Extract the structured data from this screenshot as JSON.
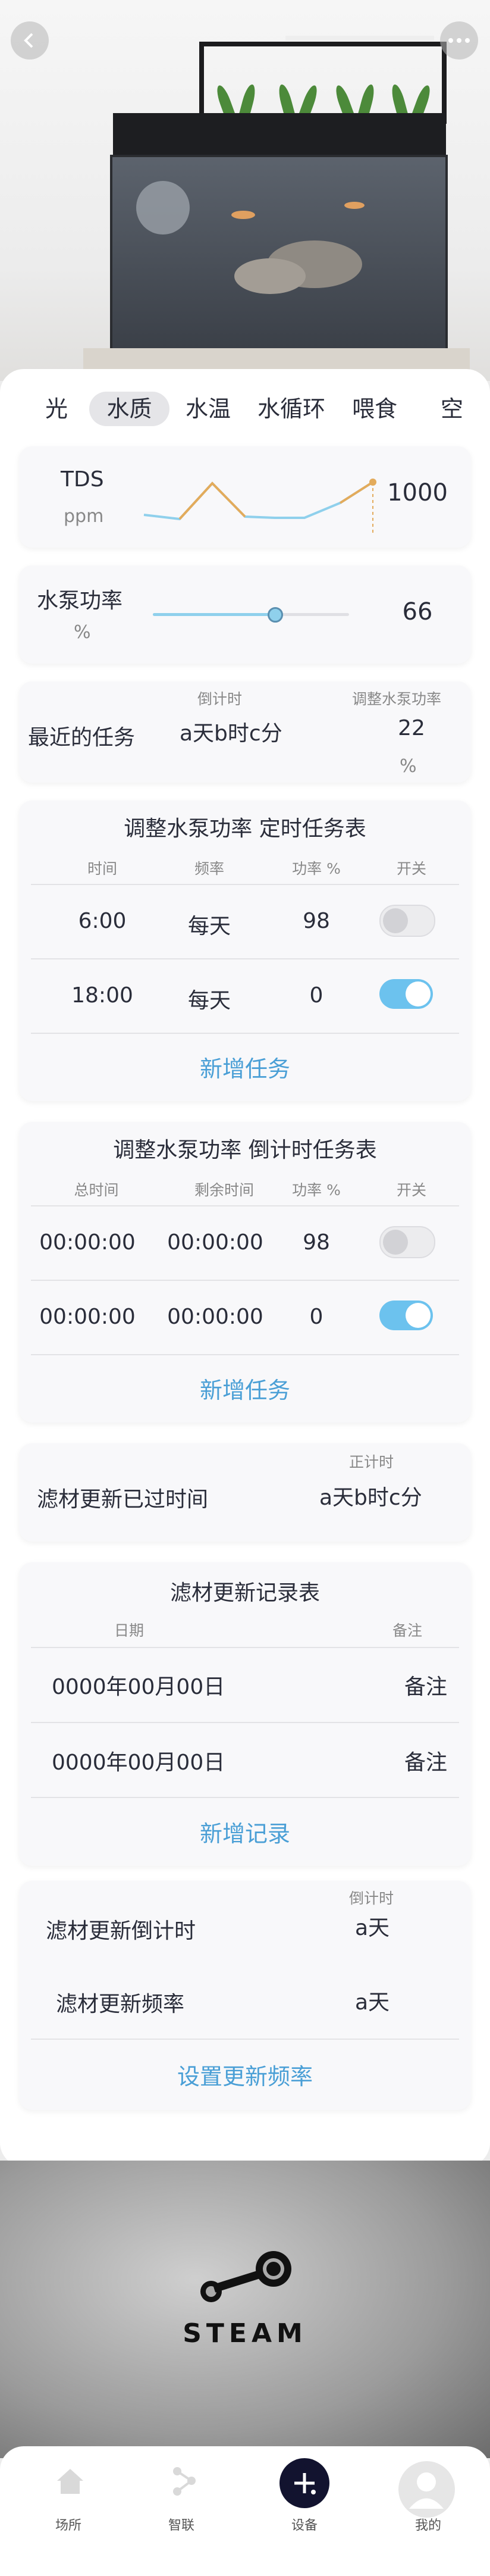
{
  "header": {
    "back_icon": "chevron-left-icon",
    "more_icon": "ellipsis-icon"
  },
  "tabs": [
    {
      "label": "光"
    },
    {
      "label": "水质"
    },
    {
      "label": "水温"
    },
    {
      "label": "水循环"
    },
    {
      "label": "喂食"
    },
    {
      "label": "空"
    }
  ],
  "tds": {
    "title": "TDS",
    "unit": "ppm",
    "value": "1000",
    "line_color": "#8fd0ec",
    "highlight_color": "#e3ab5b"
  },
  "pump_power": {
    "title": "水泵功率",
    "unit": "%",
    "value": "66",
    "level_percent": 62
  },
  "recent_task": {
    "title": "最近的任务",
    "countdown_label": "倒计时",
    "countdown_value": "a天b时c分",
    "adjust_label": "调整水泵功率",
    "adjust_value": "22",
    "adjust_unit": "%"
  },
  "schedule": {
    "title": "调整水泵功率 定时任务表",
    "headers": [
      "时间",
      "频率",
      "功率 %",
      "开关"
    ],
    "rows": [
      {
        "time": "6:00",
        "freq": "每天",
        "power": "98",
        "on": false
      },
      {
        "time": "18:00",
        "freq": "每天",
        "power": "0",
        "on": true
      }
    ],
    "add_label": "新增任务"
  },
  "countdown_table": {
    "title": "调整水泵功率 倒计时任务表",
    "headers": [
      "总时间",
      "剩余时间",
      "功率 %",
      "开关"
    ],
    "rows": [
      {
        "total": "00:00:00",
        "remain": "00:00:00",
        "power": "98",
        "on": false
      },
      {
        "total": "00:00:00",
        "remain": "00:00:00",
        "power": "0",
        "on": true
      }
    ],
    "add_label": "新增任务"
  },
  "filter_elapsed": {
    "title": "滤材更新已过时间",
    "label": "正计时",
    "value": "a天b时c分"
  },
  "filter_records": {
    "title": "滤材更新记录表",
    "headers": [
      "日期",
      "备注"
    ],
    "rows": [
      {
        "date": "0000年00月00日",
        "note": "备注"
      },
      {
        "date": "0000年00月00日",
        "note": "备注"
      }
    ],
    "add_label": "新增记录"
  },
  "filter_countdown": {
    "title": "滤材更新倒计时",
    "label": "倒计时",
    "value": "a天",
    "freq_title": "滤材更新频率",
    "freq_value": "a天",
    "set_label": "设置更新频率"
  },
  "banner": {
    "brand": "STEAM"
  },
  "nav": [
    {
      "label": "场所",
      "icon": "home-icon"
    },
    {
      "label": "智联",
      "icon": "share-icon"
    },
    {
      "label": "设备",
      "icon": "plus-icon"
    },
    {
      "label": "我的",
      "icon": "user-icon"
    }
  ]
}
